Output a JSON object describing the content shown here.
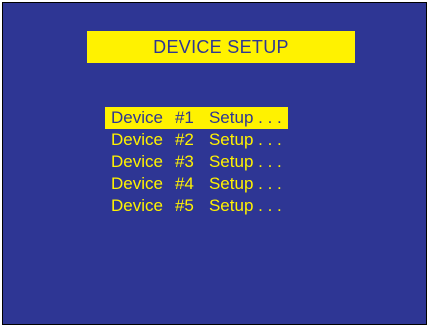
{
  "screen": {
    "title": "DEVICE SETUP",
    "colors": {
      "background": "#2e3694",
      "accent": "#fff200"
    }
  },
  "menu": {
    "selected_index": 0,
    "items": [
      {
        "device": "Device",
        "number": "#1",
        "action": "Setup . . ."
      },
      {
        "device": "Device",
        "number": "#2",
        "action": "Setup . . ."
      },
      {
        "device": "Device",
        "number": "#3",
        "action": "Setup . . ."
      },
      {
        "device": "Device",
        "number": "#4",
        "action": "Setup . . ."
      },
      {
        "device": "Device",
        "number": "#5",
        "action": "Setup . . ."
      }
    ]
  }
}
